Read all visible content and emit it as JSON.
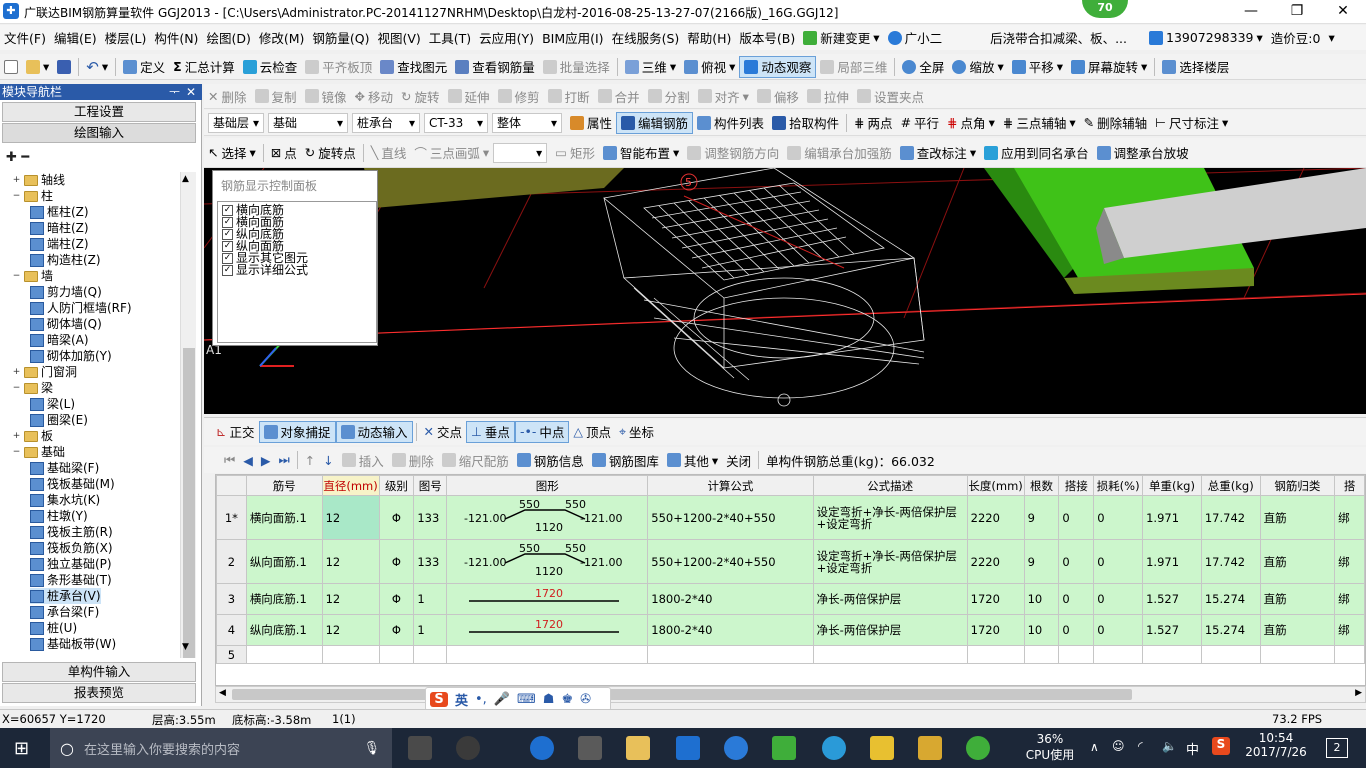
{
  "window": {
    "title": "广联达BIM钢筋算量软件 GGJ2013 - [C:\\Users\\Administrator.PC-20141127NRHM\\Desktop\\白龙村-2016-08-25-13-27-07(2166版)_16G.GGJ12]",
    "badge": "70",
    "min": "—",
    "max": "❐",
    "close": "✕"
  },
  "menu": {
    "items": [
      "文件(F)",
      "编辑(E)",
      "楼层(L)",
      "构件(N)",
      "绘图(D)",
      "修改(M)",
      "钢筋量(Q)",
      "视图(V)",
      "工具(T)",
      "云应用(Y)",
      "BIM应用(I)",
      "在线服务(S)",
      "帮助(H)",
      "版本号(B)"
    ],
    "new_change": "新建变更",
    "assistant": "广小二",
    "notice": "后浇带合扣减梁、板、...",
    "phone": "13907298339",
    "beans": "造价豆:0"
  },
  "toolbar1": {
    "define": "定义",
    "sum": "汇总计算",
    "cloud_check": "云检查",
    "flat_top": "平齐板顶",
    "find": "查找图元",
    "view_rebar": "查看钢筋量",
    "batch": "批量选择",
    "view3d": "三维",
    "top_view": "俯视",
    "dynamic": "动态观察",
    "local3d": "局部三维",
    "fullscreen": "全屏",
    "zoom": "缩放",
    "pan": "平移",
    "rotate": "屏幕旋转",
    "select_floor": "选择楼层"
  },
  "left": {
    "title": "模块导航栏",
    "pin": "ᅮ",
    "close": "✕",
    "btn_settings": "工程设置",
    "btn_draw": "绘图输入",
    "btn_single": "单构件输入",
    "btn_report": "报表预览",
    "tree": [
      {
        "label": "轴线",
        "level": 0,
        "type": "folder",
        "exp": "+"
      },
      {
        "label": "柱",
        "level": 0,
        "type": "folder",
        "exp": "−"
      },
      {
        "label": "框柱(Z)",
        "level": 1,
        "type": "leaf"
      },
      {
        "label": "暗柱(Z)",
        "level": 1,
        "type": "leaf"
      },
      {
        "label": "端柱(Z)",
        "level": 1,
        "type": "leaf"
      },
      {
        "label": "构造柱(Z)",
        "level": 1,
        "type": "leaf"
      },
      {
        "label": "墙",
        "level": 0,
        "type": "folder",
        "exp": "−"
      },
      {
        "label": "剪力墙(Q)",
        "level": 1,
        "type": "leaf"
      },
      {
        "label": "人防门框墙(RF)",
        "level": 1,
        "type": "leaf"
      },
      {
        "label": "砌体墙(Q)",
        "level": 1,
        "type": "leaf"
      },
      {
        "label": "暗梁(A)",
        "level": 1,
        "type": "leaf"
      },
      {
        "label": "砌体加筋(Y)",
        "level": 1,
        "type": "leaf"
      },
      {
        "label": "门窗洞",
        "level": 0,
        "type": "folder",
        "exp": "+"
      },
      {
        "label": "梁",
        "level": 0,
        "type": "folder",
        "exp": "−"
      },
      {
        "label": "梁(L)",
        "level": 1,
        "type": "leaf"
      },
      {
        "label": "圈梁(E)",
        "level": 1,
        "type": "leaf"
      },
      {
        "label": "板",
        "level": 0,
        "type": "folder",
        "exp": "+"
      },
      {
        "label": "基础",
        "level": 0,
        "type": "folder",
        "exp": "−"
      },
      {
        "label": "基础梁(F)",
        "level": 1,
        "type": "leaf"
      },
      {
        "label": "筏板基础(M)",
        "level": 1,
        "type": "leaf"
      },
      {
        "label": "集水坑(K)",
        "level": 1,
        "type": "leaf"
      },
      {
        "label": "柱墩(Y)",
        "level": 1,
        "type": "leaf"
      },
      {
        "label": "筏板主筋(R)",
        "level": 1,
        "type": "leaf"
      },
      {
        "label": "筏板负筋(X)",
        "level": 1,
        "type": "leaf"
      },
      {
        "label": "独立基础(P)",
        "level": 1,
        "type": "leaf"
      },
      {
        "label": "条形基础(T)",
        "level": 1,
        "type": "leaf"
      },
      {
        "label": "桩承台(V)",
        "level": 1,
        "type": "leaf",
        "selected": true
      },
      {
        "label": "承台梁(F)",
        "level": 1,
        "type": "leaf"
      },
      {
        "label": "桩(U)",
        "level": 1,
        "type": "leaf"
      },
      {
        "label": "基础板带(W)",
        "level": 1,
        "type": "leaf"
      }
    ]
  },
  "toolbar2": {
    "delete": "删除",
    "copy": "复制",
    "mirror": "镜像",
    "move": "移动",
    "rotate": "旋转",
    "extend": "延伸",
    "trim": "修剪",
    "break": "打断",
    "merge": "合并",
    "split": "分割",
    "align": "对齐",
    "offset": "偏移",
    "stretch": "拉伸",
    "set_grip": "设置夹点"
  },
  "toolbar3": {
    "floor": "基础层",
    "category": "基础",
    "type": "桩承台",
    "component": "CT-33",
    "mode": "整体",
    "props": "属性",
    "edit_rebar": "编辑钢筋",
    "comp_list": "构件列表",
    "pick": "拾取构件",
    "two_point": "两点",
    "parallel": "平行",
    "angle_point": "点角",
    "three_point_axis": "三点辅轴",
    "delete_axis": "删除辅轴",
    "dimension": "尺寸标注"
  },
  "toolbar4": {
    "select": "选择",
    "point": "点",
    "rotate_point": "旋转点",
    "line": "直线",
    "arc3": "三点画弧",
    "rect": "矩形",
    "smart": "智能布置",
    "adjust_dir": "调整钢筋方向",
    "edit_cap": "编辑承台加强筋",
    "check_label": "查改标注",
    "apply_same": "应用到同名承台",
    "adjust_slope": "调整承台放坡"
  },
  "viewport": {
    "axis_label": "A1",
    "num_label": "5"
  },
  "ctrl_panel": {
    "title": "钢筋显示控制面板",
    "options": [
      "横向底筋",
      "横向面筋",
      "纵向底筋",
      "纵向面筋",
      "显示其它图元",
      "显示详细公式"
    ]
  },
  "toolbar5": {
    "ortho": "正交",
    "snap": "对象捕捉",
    "dyn_input": "动态输入",
    "intersect": "交点",
    "perp": "垂点",
    "mid": "中点",
    "vertex": "顶点",
    "coord": "坐标"
  },
  "toolbar6": {
    "insert": "插入",
    "delete": "删除",
    "scale": "缩尺配筋",
    "info": "钢筋信息",
    "lib": "钢筋图库",
    "other": "其他",
    "close": "关闭",
    "total": "单构件钢筋总重(kg)：66.032"
  },
  "grid": {
    "headers": [
      "",
      "筋号",
      "直径(mm)",
      "级别",
      "图号",
      "图形",
      "计算公式",
      "公式描述",
      "长度(mm)",
      "根数",
      "搭接",
      "损耗(%)",
      "单重(kg)",
      "总重(kg)",
      "钢筋归类",
      "搭"
    ],
    "rows": [
      {
        "rn": "1*",
        "name": "横向面筋.1",
        "diam": "12",
        "grade": "Φ",
        "fig": "133",
        "shape": {
          "kind": "bent",
          "left": "-121.00",
          "mid": "1120",
          "top1": "550",
          "top2": "550",
          "right": "-121.00"
        },
        "formula": "550+1200-2*40+550",
        "desc": "设定弯折+净长-两倍保护层+设定弯折",
        "len": "2220",
        "count": "9",
        "lap": "0",
        "loss": "0",
        "unit": "1.971",
        "total": "17.742",
        "cat": "直筋",
        "extra": "绑"
      },
      {
        "rn": "2",
        "name": "纵向面筋.1",
        "diam": "12",
        "grade": "Φ",
        "fig": "133",
        "shape": {
          "kind": "bent",
          "left": "-121.00",
          "mid": "1120",
          "top1": "550",
          "top2": "550",
          "right": "-121.00"
        },
        "formula": "550+1200-2*40+550",
        "desc": "设定弯折+净长-两倍保护层+设定弯折",
        "len": "2220",
        "count": "9",
        "lap": "0",
        "loss": "0",
        "unit": "1.971",
        "total": "17.742",
        "cat": "直筋",
        "extra": "绑"
      },
      {
        "rn": "3",
        "name": "横向底筋.1",
        "diam": "12",
        "grade": "Φ",
        "fig": "1",
        "shape": {
          "kind": "straight",
          "mid": "1720"
        },
        "formula": "1800-2*40",
        "desc": "净长-两倍保护层",
        "len": "1720",
        "count": "10",
        "lap": "0",
        "loss": "0",
        "unit": "1.527",
        "total": "15.274",
        "cat": "直筋",
        "extra": "绑"
      },
      {
        "rn": "4",
        "name": "纵向底筋.1",
        "diam": "12",
        "grade": "Φ",
        "fig": "1",
        "shape": {
          "kind": "straight",
          "mid": "1720"
        },
        "formula": "1800-2*40",
        "desc": "净长-两倍保护层",
        "len": "1720",
        "count": "10",
        "lap": "0",
        "loss": "0",
        "unit": "1.527",
        "total": "15.274",
        "cat": "直筋",
        "extra": "绑"
      }
    ],
    "empty_rn": "5"
  },
  "ime": {
    "lang": "英"
  },
  "status": {
    "coord": "X=60657 Y=1720",
    "floor_h": "层高:3.55m",
    "base_h": "底标高:-3.58m",
    "count": "1(1)",
    "fps": "73.2 FPS"
  },
  "taskbar": {
    "search": "在这里输入你要搜索的内容",
    "cpu_pct": "36%",
    "cpu_label": "CPU使用",
    "lang": "中",
    "time": "10:54",
    "date": "2017/7/26",
    "notif": "2"
  },
  "colors": {
    "accent": "#1e6fd0",
    "grid_green": "#ccf6cc",
    "viewport_bg": "#000000",
    "taskbar": "#1c2738"
  }
}
